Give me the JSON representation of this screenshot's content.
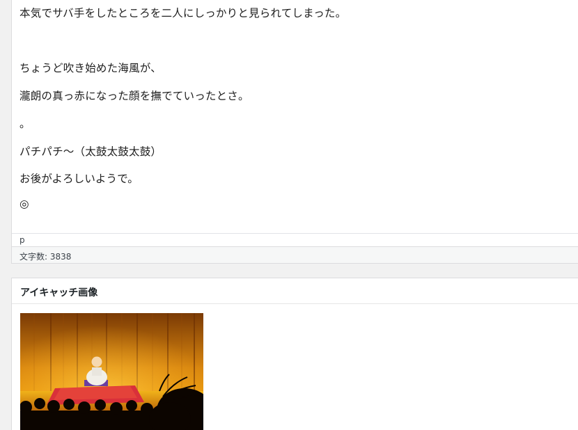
{
  "editor": {
    "paragraphs": [
      "本気でサバ手をしたところを二人にしっかりと見られてしまった。",
      "ちょうど吹き始めた海風が、",
      "瀧朗の真っ赤になった顔を撫でていったとさ。",
      "。",
      "パチパチ〜（太鼓太鼓太鼓）",
      "お後がよろしいようで。",
      "◎"
    ],
    "path": "p",
    "word_count": "文字数: 3838"
  },
  "featured_image": {
    "title": "アイキャッチ画像",
    "image_icon": "rakugo-stage-photo"
  },
  "colors": {
    "background": "#f1f1f1",
    "panel": "#ffffff",
    "border": "#dcdcde",
    "text": "#1e1e1e"
  }
}
